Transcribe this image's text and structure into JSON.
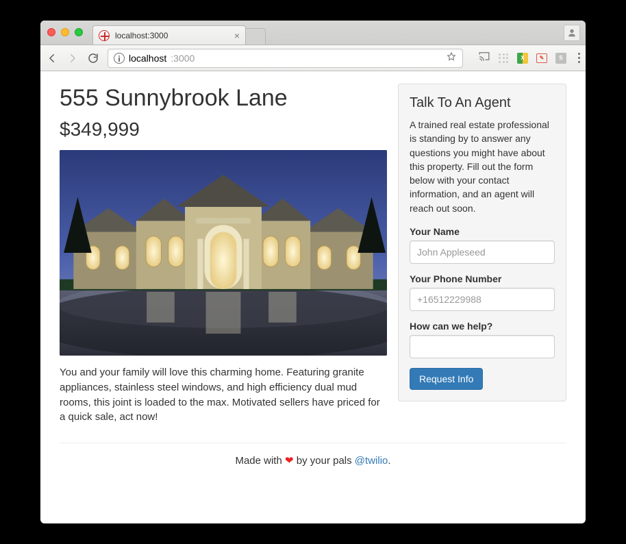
{
  "browser": {
    "tab_title": "localhost:3000",
    "url_host": "localhost",
    "url_port": ":3000"
  },
  "listing": {
    "address": "555 Sunnybrook Lane",
    "price": "$349,999",
    "description": "You and your family will love this charming home. Featuring granite appliances, stainless steel windows, and high efficiency dual mud rooms, this joint is loaded to the max. Motivated sellers have priced for a quick sale, act now!"
  },
  "sidebar": {
    "heading": "Talk To An Agent",
    "blurb": "A trained real estate professional is standing by to answer any questions you might have about this property. Fill out the form below with your contact information, and an agent will reach out soon.",
    "name_label": "Your Name",
    "name_placeholder": "John Appleseed",
    "phone_label": "Your Phone Number",
    "phone_placeholder": "+16512229988",
    "msg_label": "How can we help?",
    "submit_label": "Request Info"
  },
  "footer": {
    "prefix": "Made with ",
    "middle": " by your pals ",
    "handle": "@twilio",
    "suffix": "."
  }
}
